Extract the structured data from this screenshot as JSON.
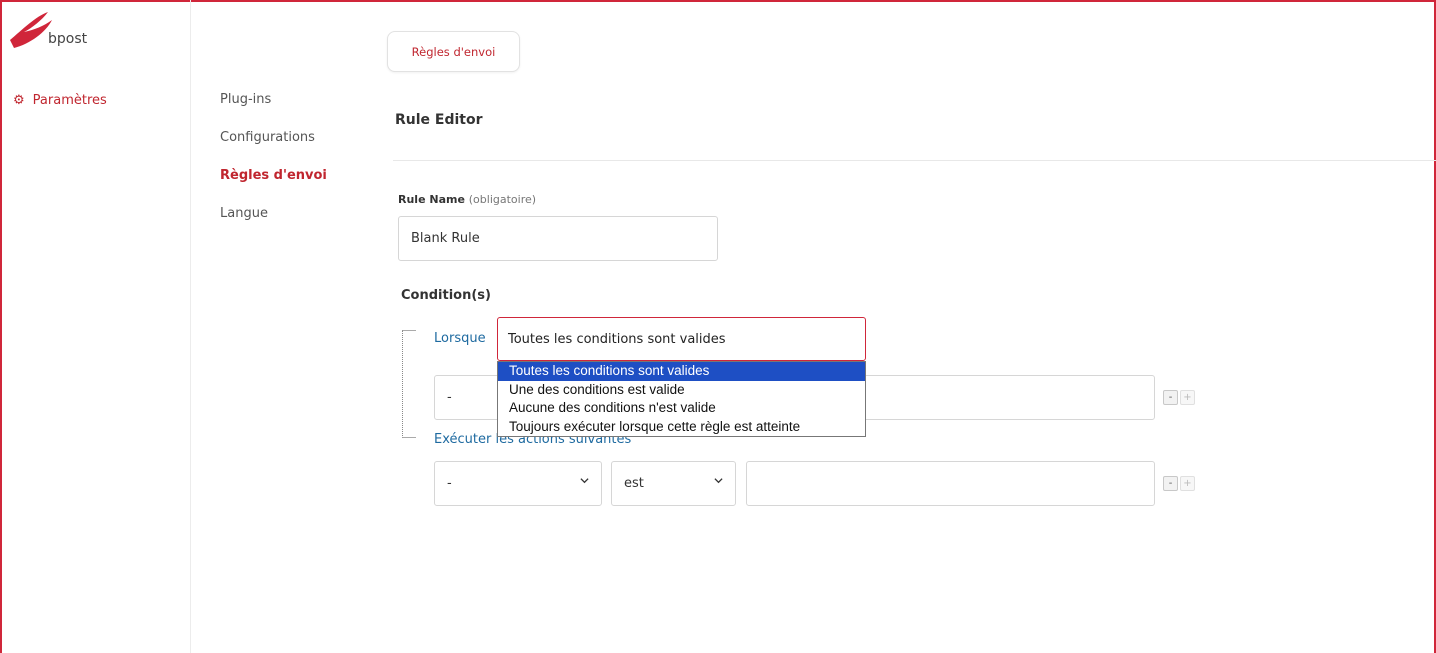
{
  "brand": {
    "name": "bpost",
    "accent_color": "#d0263a"
  },
  "rail": {
    "settings_label": "Paramètres",
    "settings_icon": "gear-icon"
  },
  "subnav": {
    "items": [
      {
        "label": "Plug-ins",
        "active": false
      },
      {
        "label": "Configurations",
        "active": false
      },
      {
        "label": "Règles d'envoi",
        "active": true
      },
      {
        "label": "Langue",
        "active": false
      }
    ]
  },
  "header": {
    "tab_label": "Règles d'envoi"
  },
  "editor": {
    "title": "Rule Editor",
    "rule_name_label": "Rule Name",
    "rule_name_hint": "(obligatoire)",
    "rule_name_value": "Blank Rule",
    "conditions_label": "Condition(s)",
    "when_label": "Lorsque",
    "match_value": "Toutes les conditions sont valides",
    "match_options": [
      "Toutes les conditions sont valides",
      "Une des conditions est valide",
      "Aucune des conditions n'est valide",
      "Toujours exécuter lorsque cette règle est atteinte"
    ],
    "condition_row": {
      "field_value": "-",
      "remove_label": "-",
      "add_label": "+"
    },
    "actions_label": "Exécuter les actions suivantes",
    "action_row": {
      "field_value": "-",
      "operator_value": "est",
      "remove_label": "-",
      "add_label": "+"
    }
  }
}
